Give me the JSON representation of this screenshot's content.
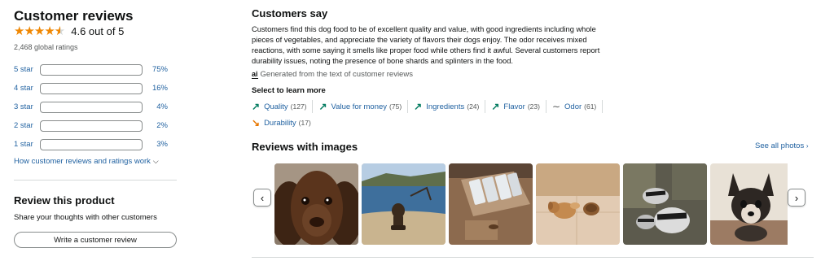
{
  "reviews": {
    "title": "Customer reviews",
    "rating_text": "4.6 out of 5",
    "rating_value": 4.6,
    "global_ratings": "2,468 global ratings",
    "histogram": [
      {
        "label": "5 star",
        "percent": "75%",
        "value": 75
      },
      {
        "label": "4 star",
        "percent": "16%",
        "value": 16
      },
      {
        "label": "3 star",
        "percent": "4%",
        "value": 4
      },
      {
        "label": "2 star",
        "percent": "2%",
        "value": 2
      },
      {
        "label": "1 star",
        "percent": "3%",
        "value": 3
      }
    ],
    "how_link": "How customer reviews and ratings work",
    "review_title": "Review this product",
    "review_sub": "Share your thoughts with other customers",
    "write_button": "Write a customer review"
  },
  "customers_say": {
    "title": "Customers say",
    "summary": "Customers find this dog food to be of excellent quality and value, with good ingredients including whole pieces of vegetables, and appreciate the variety of flavors their dogs enjoy. The odor receives mixed reactions, with some saying it smells like proper food while others find it awful. Several customers report durability issues, noting the presence of bone shards and splinters in the food.",
    "ai_label": "ai",
    "generated": "Generated from the text of customer reviews",
    "select_label": "Select to learn more",
    "chips": [
      {
        "label": "Quality",
        "count": "(127)",
        "sentiment": "positive",
        "icon": "trend-up-icon"
      },
      {
        "label": "Value for money",
        "count": "(75)",
        "sentiment": "positive",
        "icon": "trend-up-icon"
      },
      {
        "label": "Ingredients",
        "count": "(24)",
        "sentiment": "positive",
        "icon": "trend-up-icon"
      },
      {
        "label": "Flavor",
        "count": "(23)",
        "sentiment": "positive",
        "icon": "trend-up-icon"
      },
      {
        "label": "Odor",
        "count": "(61)",
        "sentiment": "mixed",
        "icon": "wave-icon"
      },
      {
        "label": "Durability",
        "count": "(17)",
        "sentiment": "negative",
        "icon": "trend-down-icon"
      }
    ]
  },
  "images": {
    "title": "Reviews with images",
    "see_all": "See all photos",
    "photos": [
      {
        "name": "brown-spaniel-photo"
      },
      {
        "name": "dog-on-beach-photo"
      },
      {
        "name": "food-packets-box-photo"
      },
      {
        "name": "puppy-eating-photo"
      },
      {
        "name": "badgers-photo"
      },
      {
        "name": "chihuahua-photo"
      }
    ]
  },
  "colors": {
    "star": "#f08804",
    "bar_fill": "#f86f00",
    "link": "#2162a1",
    "positive": "#067d62",
    "negative": "#e77600"
  }
}
